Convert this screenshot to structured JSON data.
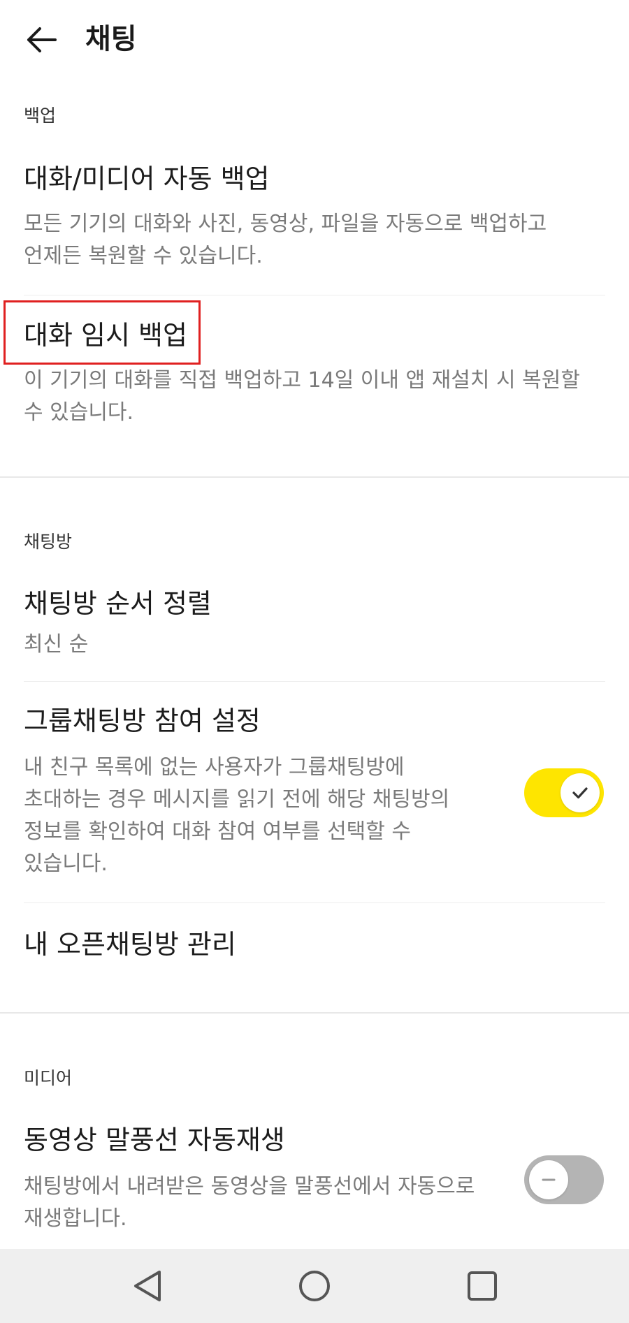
{
  "header": {
    "title": "채팅",
    "back_icon": "arrow-left-icon"
  },
  "sections": {
    "backup": {
      "label": "백업",
      "items": [
        {
          "title": "대화/미디어 자동 백업",
          "desc_lines": [
            "모든 기기의 대화와 사진, 동영상, 파일을 자동으로 백업하고",
            "언제든 복원할 수 있습니다."
          ]
        },
        {
          "title": "대화 임시 백업",
          "desc_lines": [
            "이 기기의 대화를 직접 백업하고 14일 이내 앱 재설치 시 복원할",
            "수 있습니다."
          ]
        }
      ]
    },
    "chatroom": {
      "label": "채팅방",
      "items": [
        {
          "title": "채팅방 순서 정렬",
          "value": "최신 순"
        },
        {
          "title": "그룹채팅방 참여 설정",
          "desc_lines": [
            "내 친구 목록에 없는 사용자가 그룹채팅방에",
            "초대하는 경우 메시지를 읽기 전에 해당 채팅방의",
            "정보를 확인하여 대화 참여 여부를 선택할 수",
            "있습니다."
          ],
          "toggle_on": true
        },
        {
          "title": "내 오픈채팅방 관리"
        }
      ]
    },
    "media": {
      "label": "미디어",
      "items": [
        {
          "title": "동영상 말풍선 자동재생",
          "desc_lines": [
            "채팅방에서 내려받은 동영상을 말풍선에서 자동으로",
            "재생합니다."
          ],
          "toggle_on": false
        }
      ]
    }
  },
  "colors": {
    "toggle_on": "#fee500",
    "toggle_off": "#b4b4b4",
    "highlight": "#e02020"
  },
  "navbar": {
    "icons": [
      "back-triangle-icon",
      "home-circle-icon",
      "recents-square-icon"
    ]
  }
}
